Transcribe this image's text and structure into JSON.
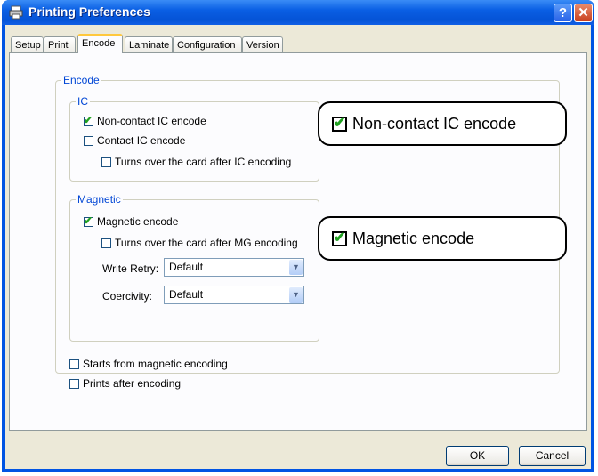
{
  "window": {
    "title": "Printing Preferences"
  },
  "tabs": [
    "Setup",
    "Print",
    "Encode",
    "Laminate",
    "Configuration",
    "Version"
  ],
  "active_tab": "Encode",
  "encode": {
    "group_label": "Encode",
    "ic": {
      "label": "IC",
      "non_contact": {
        "label": "Non-contact IC encode",
        "checked": true
      },
      "contact": {
        "label": "Contact IC encode",
        "checked": false
      },
      "turn_over": {
        "label": "Turns over the card after IC encoding",
        "checked": false
      }
    },
    "magnetic": {
      "label": "Magnetic",
      "encode": {
        "label": "Magnetic encode",
        "checked": true
      },
      "turn_over": {
        "label": "Turns over the card after MG encoding",
        "checked": false
      },
      "write_retry": {
        "label": "Write Retry:",
        "value": "Default"
      },
      "coercivity": {
        "label": "Coercivity:",
        "value": "Default"
      }
    },
    "starts_from_mg": {
      "label": "Starts from magnetic encoding",
      "checked": false
    },
    "prints_after": {
      "label": "Prints after encoding",
      "checked": false
    }
  },
  "callouts": {
    "non_contact": "Non-contact IC encode",
    "magnetic": "Magnetic encode"
  },
  "buttons": {
    "ok": "OK",
    "cancel": "Cancel"
  },
  "colors": {
    "title_bar": "#0a5fe4",
    "group_label": "#0046d5",
    "check": "#21a121"
  }
}
